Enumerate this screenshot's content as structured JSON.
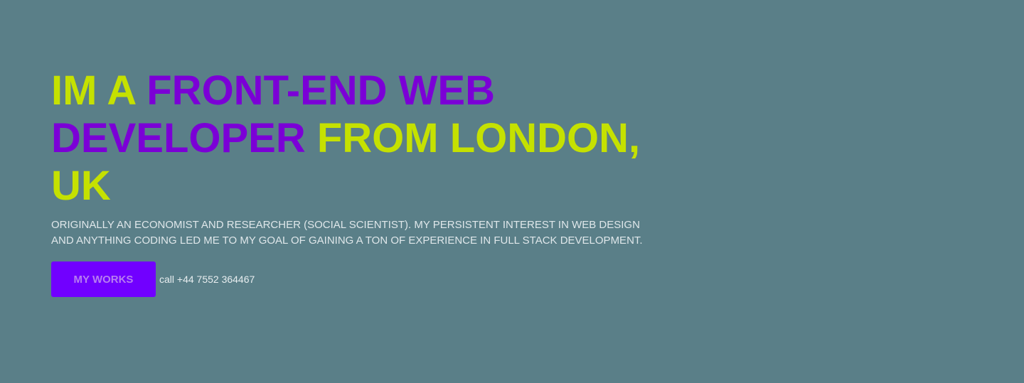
{
  "colors": {
    "background": "#5a7f88",
    "accent_yellow": "#c5e100",
    "accent_purple": "#7b00d6",
    "button": "#7100ff"
  },
  "hero": {
    "headline": {
      "part1": "IM A ",
      "part2": "FRONT-END WEB DEVELOPER",
      "part3": " FROM LONDON, UK"
    },
    "intro": "ORIGINALLY AN ECONOMIST AND RESEARCHER (SOCIAL SCIENTIST). MY PERSISTENT INTEREST IN WEB DESIGN AND ANYTHING CODING LED ME TO MY GOAL OF GAINING A TON OF EXPERIENCE IN FULL STACK DEVELOPMENT.",
    "works_button": "MY WORKS",
    "phone": "call +44 7552 364467"
  }
}
